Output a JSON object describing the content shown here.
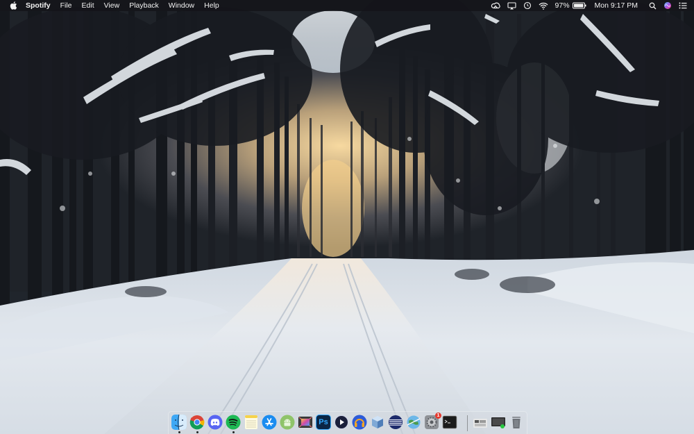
{
  "menubar": {
    "app_name": "Spotify",
    "menus": [
      "File",
      "Edit",
      "View",
      "Playback",
      "Window",
      "Help"
    ],
    "battery_percent": "97%",
    "clock": "Mon 9:17 PM",
    "icons": [
      "creative-cloud-icon",
      "airplay-icon",
      "time-machine-icon",
      "wifi-icon",
      "battery-icon",
      "spotlight-search-icon",
      "siri-icon",
      "notification-center-icon"
    ]
  },
  "wallpaper": {
    "scene": "snowy-forest-road"
  },
  "dock": {
    "apps": [
      {
        "name": "Finder",
        "icon": "finder-icon",
        "running": true
      },
      {
        "name": "Google Chrome",
        "icon": "chrome-icon",
        "running": true
      },
      {
        "name": "Discord",
        "icon": "discord-icon",
        "running": false
      },
      {
        "name": "Spotify",
        "icon": "spotify-icon",
        "running": true
      },
      {
        "name": "Notes",
        "icon": "notes-icon",
        "running": false
      },
      {
        "name": "App Store",
        "icon": "app-store-icon",
        "running": false
      },
      {
        "name": "Android File Transfer",
        "icon": "android-icon",
        "running": false
      },
      {
        "name": "Final Cut Pro",
        "icon": "final-cut-icon",
        "running": false
      },
      {
        "name": "Photoshop",
        "icon": "photoshop-icon",
        "label": "Ps",
        "running": false
      },
      {
        "name": "Player",
        "icon": "play-circle-icon",
        "running": false
      },
      {
        "name": "Headphones",
        "icon": "headphones-icon",
        "running": false
      },
      {
        "name": "Cube",
        "icon": "cube-icon",
        "running": false
      },
      {
        "name": "Striped App",
        "icon": "striped-icon",
        "running": false
      },
      {
        "name": "Network",
        "icon": "globe-icon",
        "running": false
      },
      {
        "name": "System Preferences",
        "icon": "system-preferences-icon",
        "badge": "1",
        "running": false
      },
      {
        "name": "Terminal",
        "icon": "terminal-icon",
        "running": false
      }
    ],
    "others": [
      {
        "name": "Folder",
        "icon": "folder-stack-icon"
      },
      {
        "name": "Screen",
        "icon": "screen-icon"
      },
      {
        "name": "Trash",
        "icon": "trash-icon"
      }
    ]
  },
  "colors": {
    "menubar_bg": "#141418",
    "menubar_text": "#f2f2f2",
    "dock_bg": "#d2d7de",
    "snow": "#e8ecf1",
    "spotify_green": "#1db954",
    "chrome_red": "#db4437",
    "discord_blurple": "#5865f2"
  }
}
